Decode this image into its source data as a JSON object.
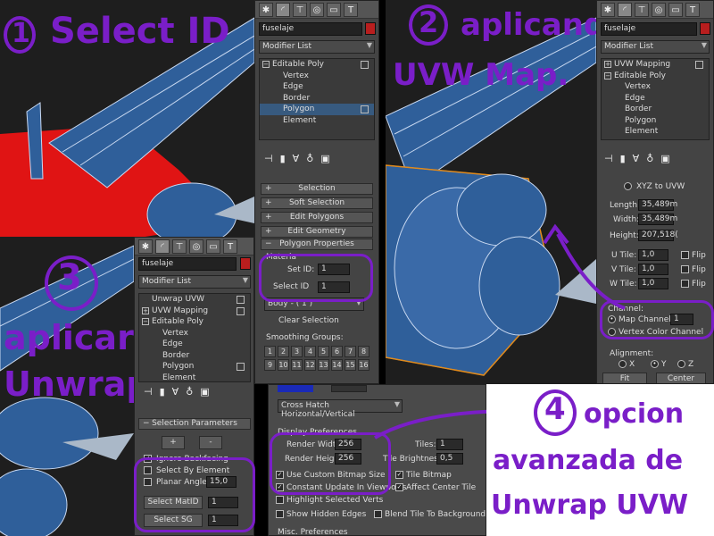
{
  "colors": {
    "annotation": "#7a1ec8",
    "material_red": "#b81e1e",
    "selection_blue": "#375a7f",
    "panel_bg": "#444444"
  },
  "annotations": {
    "step1": {
      "num": "1",
      "text": "Select ID"
    },
    "step2": {
      "num": "2",
      "line1": "aplicando",
      "line2": "UVW Map."
    },
    "step3": {
      "num": "3",
      "line1": "aplicar",
      "line2": "Unwrap."
    },
    "step4": {
      "num": "4",
      "line1": "opcion",
      "line2": "avanzada de",
      "line3": "Unwrap UVW"
    }
  },
  "toolbar_icons": [
    "create-icon",
    "modify-icon",
    "hierarchy-icon",
    "motion-icon",
    "display-icon",
    "utilities-icon"
  ],
  "panel1": {
    "object_name": "fuselaje",
    "modifier_list": "Modifier List",
    "stack": [
      {
        "label": "Editable Poly",
        "root": true
      },
      {
        "label": "Vertex"
      },
      {
        "label": "Edge"
      },
      {
        "label": "Border"
      },
      {
        "label": "Polygon",
        "selected": true
      },
      {
        "label": "Element"
      }
    ],
    "rollouts": [
      "Selection",
      "Soft Selection",
      "Edit Polygons",
      "Edit Geometry",
      "Polygon Properties"
    ],
    "material_label": "Materia",
    "set_id_label": "Set ID:",
    "set_id_value": "1",
    "select_id_label": "Select ID",
    "select_id_value": "1",
    "id_dropdown": "Body - ( 1 )",
    "clear_selection": "Clear Selection",
    "smoothing_label": "Smoothing Groups:",
    "smoothing_groups": [
      "1",
      "2",
      "3",
      "4",
      "5",
      "6",
      "7",
      "8",
      "9",
      "10",
      "11",
      "12",
      "13",
      "14",
      "15",
      "16"
    ]
  },
  "panel2": {
    "object_name": "fuselaje",
    "modifier_list": "Modifier List",
    "stack": [
      {
        "label": "UVW Mapping",
        "root": true
      },
      {
        "label": "Editable Poly",
        "root": true
      },
      {
        "label": "Vertex"
      },
      {
        "label": "Edge"
      },
      {
        "label": "Border"
      },
      {
        "label": "Polygon"
      },
      {
        "label": "Element"
      }
    ],
    "xyz_to_uvw": "XYZ to UVW",
    "length_label": "Length:",
    "length_value": "35,489m",
    "width_label": "Width:",
    "width_value": "35,489m",
    "height_label": "Height:",
    "height_value": "207,518(",
    "u_tile_label": "U Tile:",
    "u_tile_value": "1,0",
    "v_tile_label": "V Tile:",
    "v_tile_value": "1,0",
    "w_tile_label": "W Tile:",
    "w_tile_value": "1,0",
    "flip_label": "Flip",
    "channel_label": "Channel:",
    "map_channel_label": "Map Channel:",
    "map_channel_value": "1",
    "vertex_color_channel": "Vertex Color Channel",
    "alignment_label": "Alignment:",
    "align_x": "X",
    "align_y": "Y",
    "align_z": "Z",
    "fit_label": "Fit",
    "center_label": "Center"
  },
  "panel3": {
    "object_name": "fuselaje",
    "modifier_list": "Modifier List",
    "stack": [
      {
        "label": "Unwrap UVW",
        "root": true
      },
      {
        "label": "UVW Mapping",
        "root": true
      },
      {
        "label": "Editable Poly",
        "root": true
      },
      {
        "label": "Vertex"
      },
      {
        "label": "Edge"
      },
      {
        "label": "Border"
      },
      {
        "label": "Polygon"
      },
      {
        "label": "Element"
      }
    ],
    "rollout": "Selection Parameters",
    "plus": "+",
    "minus": "-",
    "ignore_backfacing": "Ignore Backfacing",
    "select_by_element": "Select By Element",
    "planar_angle_label": "Planar Angle",
    "planar_angle_value": "15,0",
    "select_matid": "Select MatID",
    "select_matid_value": "1",
    "select_sg": "Select SG",
    "select_sg_value": "1"
  },
  "panel4": {
    "background_dropdown": "Cross Hatch Horizontal/Vertical",
    "display_prefs_label": "Display Preferences",
    "render_width_label": "Render Width:",
    "render_width_value": "256",
    "render_height_label": "Render Height:",
    "render_height_value": "256",
    "tiles_label": "Tiles:",
    "tiles_value": "1",
    "tile_brightness_label": "Tile Brightness:",
    "tile_brightness_value": "0,5",
    "use_custom_bitmap": "Use Custom Bitmap Size",
    "tile_bitmap": "Tile Bitmap",
    "constant_update": "Constant Update In Viewports",
    "affect_center_tile": "Affect Center Tile",
    "highlight_selected_verts": "Highlight Selected Verts",
    "show_hidden_edges": "Show Hidden Edges",
    "blend_tile": "Blend Tile To Background",
    "misc_preferences": "Misc. Preferences"
  }
}
